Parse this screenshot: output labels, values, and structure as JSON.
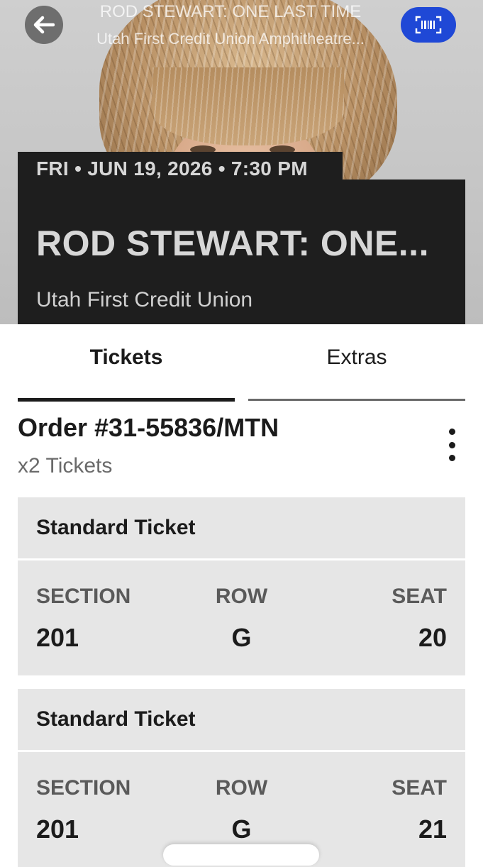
{
  "header": {
    "title": "ROD STEWART: ONE LAST TIME",
    "venue_full": "Utah First Credit Union Amphitheatre..."
  },
  "event": {
    "date_line": "FRI • JUN 19, 2026 • 7:30 PM",
    "title": "ROD STEWART: ONE...",
    "venue": "Utah First Credit Union"
  },
  "tabs": [
    {
      "label": "Tickets",
      "active": true
    },
    {
      "label": "Extras",
      "active": false
    }
  ],
  "order": {
    "number": "Order #31-55836/MTN",
    "count": "x2 Tickets"
  },
  "tickets": [
    {
      "type": "Standard Ticket",
      "section_label": "SECTION",
      "section": "201",
      "row_label": "ROW",
      "row": "G",
      "seat_label": "SEAT",
      "seat": "20"
    },
    {
      "type": "Standard Ticket",
      "section_label": "SECTION",
      "section": "201",
      "row_label": "ROW",
      "row": "G",
      "seat_label": "SEAT",
      "seat": "21"
    }
  ],
  "icons": {
    "back": "arrow-left-icon",
    "scan": "barcode-scan-icon",
    "menu": "more-vertical-icon"
  },
  "colors": {
    "accent": "#1f48d6",
    "panel": "#1e1e1e",
    "card": "#e6e6e6"
  }
}
